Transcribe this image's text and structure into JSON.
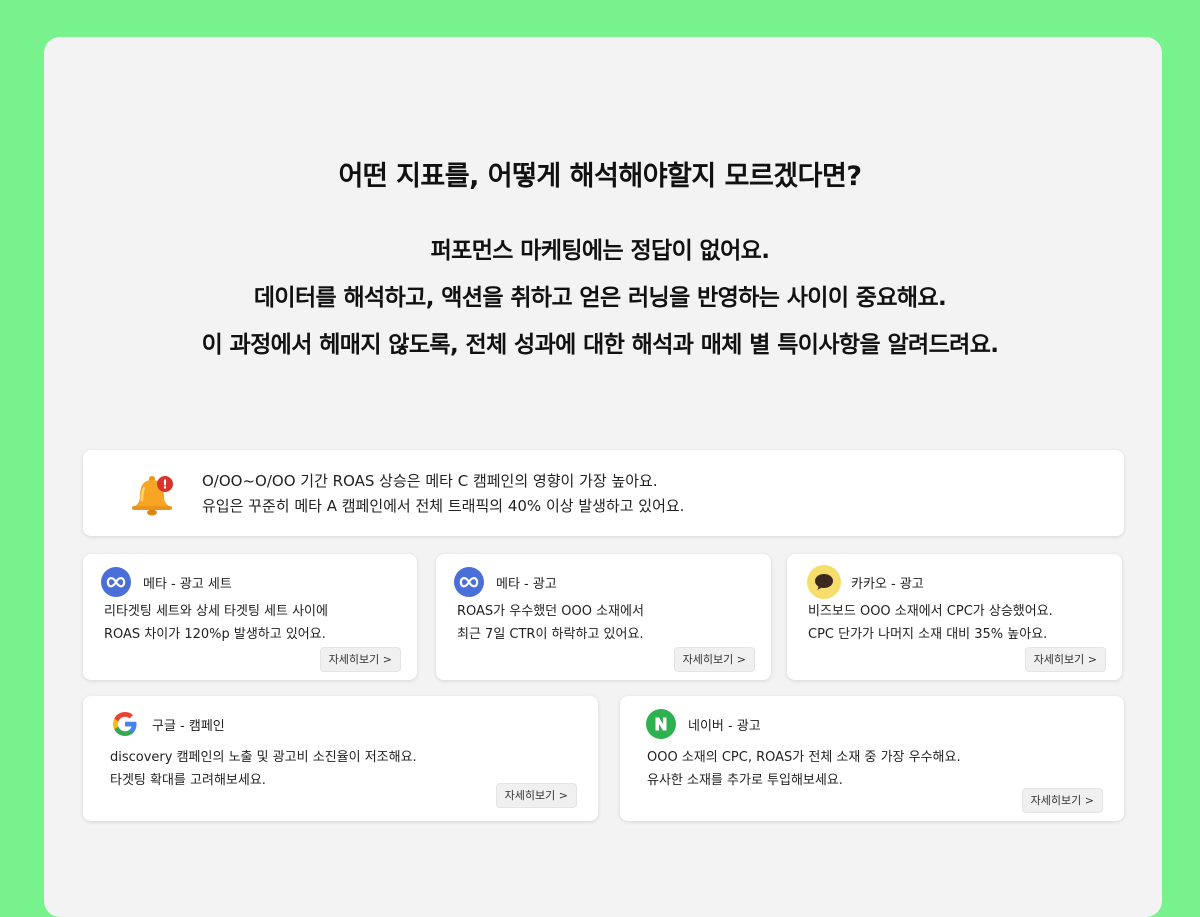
{
  "headline": "어떤 지표를, 어떻게 해석해야할지 모르겠다면?",
  "intro_lines": [
    "퍼포먼스 마케팅에는 정답이 없어요.",
    "데이터를 해석하고, 액션을 취하고 얻은 러닝을 반영하는 사이이 중요해요.",
    "이 과정에서 헤매지 않도록, 전체 성과에 대한 해석과 매체 별 특이사항을 알려드려요."
  ],
  "alert": {
    "icon": "bell-icon",
    "badge": "!",
    "lines": [
      "O/OO~O/OO 기간 ROAS 상승은 메타 C 캠페인의 영향이 가장 높아요.",
      "유입은 꾸준히 메타 A 캠페인에서 전체 트래픽의 40% 이상 발생하고 있어요."
    ]
  },
  "cards": [
    {
      "icon": "meta-icon",
      "source": "메타 - 광고 세트",
      "lines": [
        "리타겟팅 세트와 상세 타겟팅 세트 사이에",
        "ROAS 차이가 120%p 발생하고 있어요."
      ],
      "more": "자세히보기 >"
    },
    {
      "icon": "meta-icon",
      "source": "메타 - 광고",
      "lines": [
        "ROAS가 우수했던 OOO 소재에서",
        "최근 7일 CTR이 하락하고 있어요."
      ],
      "more": "자세히보기 >"
    },
    {
      "icon": "kakao-icon",
      "source": "카카오 - 광고",
      "lines": [
        "비즈보드 OOO 소재에서 CPC가 상승했어요.",
        "CPC 단가가 나머지 소재 대비 35% 높아요."
      ],
      "more": "자세히보기 >"
    },
    {
      "icon": "google-icon",
      "source": "구글 - 캠페인",
      "lines": [
        "discovery 캠페인의 노출 및 광고비 소진율이 저조해요.",
        "타겟팅 확대를 고려해보세요."
      ],
      "more": "자세히보기 >"
    },
    {
      "icon": "naver-icon",
      "source": "네이버 - 광고",
      "lines": [
        "OOO 소재의 CPC, ROAS가 전체 소재 중 가장 우수해요.",
        "유사한 소재를 추가로 투입해보세요."
      ],
      "more": "자세히보기 >"
    }
  ],
  "colors": {
    "background": "#78f28c",
    "panel": "#f3f3f3",
    "meta": "#4a6fd8",
    "kakao": "#f7dd6b",
    "naver": "#2db24f",
    "bell": "#f6a623",
    "badge": "#d9342b"
  }
}
